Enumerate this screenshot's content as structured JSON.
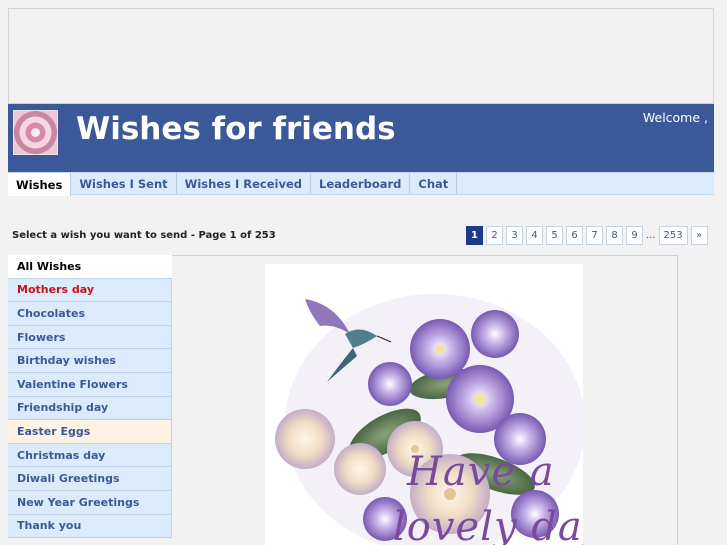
{
  "header": {
    "site_title": "Wishes for friends",
    "welcome_text": "Welcome ,"
  },
  "tabs": [
    {
      "label": "Wishes",
      "active": true
    },
    {
      "label": "Wishes I Sent"
    },
    {
      "label": "Wishes I Received"
    },
    {
      "label": "Leaderboard"
    },
    {
      "label": "Chat"
    }
  ],
  "page_info": {
    "select_label": "Select a wish you want to send - Page 1 of 253"
  },
  "pagination": {
    "current": "1",
    "pages": [
      "2",
      "3",
      "4",
      "5",
      "6",
      "7",
      "8",
      "9"
    ],
    "ellipsis": "...",
    "last": "253",
    "next": "»"
  },
  "categories": [
    {
      "label": "All Wishes",
      "selected": true
    },
    {
      "label": "Mothers day",
      "highlight": true
    },
    {
      "label": "Chocolates"
    },
    {
      "label": "Flowers"
    },
    {
      "label": "Birthday wishes"
    },
    {
      "label": "Valentine Flowers"
    },
    {
      "label": "Friendship day"
    },
    {
      "label": "Easter Eggs",
      "alt": true
    },
    {
      "label": "Christmas day"
    },
    {
      "label": "Diwali Greetings"
    },
    {
      "label": "New Year Greetings"
    },
    {
      "label": "Thank you"
    }
  ],
  "wish_card": {
    "line1": "Have a",
    "line2": "lovely day"
  },
  "colors": {
    "brand_blue": "#3b5998",
    "tab_bg": "#dcebfb",
    "pager_current": "#1b3a8c",
    "highlight_red": "#cc1111"
  }
}
